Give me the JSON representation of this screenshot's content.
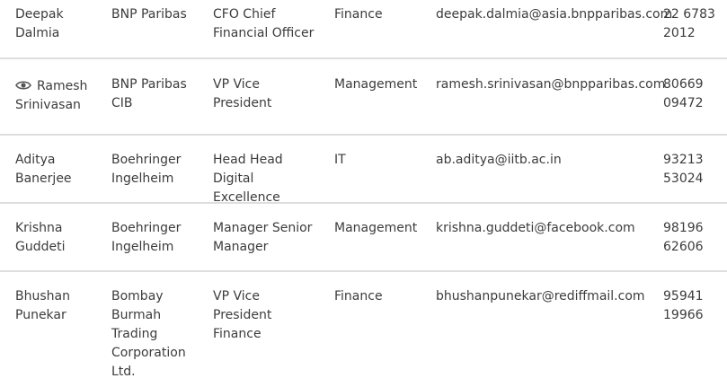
{
  "rows": [
    {
      "name": "Deepak Dalmia",
      "company": "BNP Paribas",
      "title": "CFO Chief Financial Officer",
      "department": "Finance",
      "email": "deepak.dalmia@asia.bnpparibas.com",
      "phone": "22 6783 2012",
      "viewed": false
    },
    {
      "name": "Ramesh Srinivasan",
      "company": "BNP Paribas CIB",
      "title": "VP Vice President",
      "department": "Management",
      "email": "ramesh.srinivasan@bnpparibas.com",
      "phone": "80669 09472",
      "viewed": true,
      "icon": "eye-icon"
    },
    {
      "name": "Aditya Banerjee",
      "company": "Boehringer Ingelheim",
      "title": "Head Head Digital Excellence",
      "department": "IT",
      "email": "ab.aditya@iitb.ac.in",
      "phone": "93213 53024",
      "viewed": false
    },
    {
      "name": "Krishna Guddeti",
      "company": "Boehringer Ingelheim",
      "title": "Manager Senior Manager",
      "department": "Management",
      "email": "krishna.guddeti@facebook.com",
      "phone": "98196 62606",
      "viewed": false
    },
    {
      "name": "Bhushan Punekar",
      "company": "Bombay Burmah Trading Corporation Ltd.",
      "title": "VP Vice President Finance",
      "department": "Finance",
      "email": "bhushanpunekar@rediffmail.com",
      "phone": "95941 19966",
      "viewed": false
    }
  ],
  "colors": {
    "text": "#3c3c3c",
    "divider": "#dedede",
    "icon": "#555555"
  }
}
